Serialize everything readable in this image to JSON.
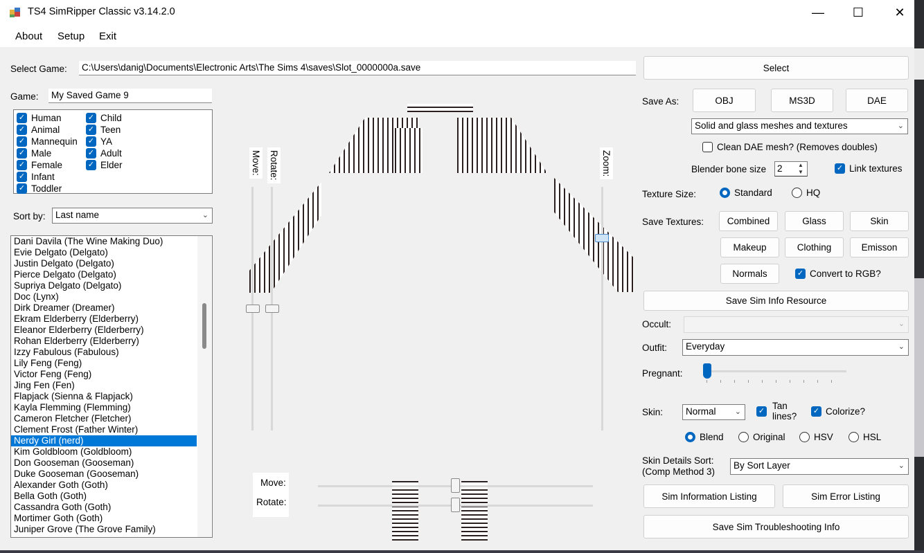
{
  "window": {
    "title": "TS4 SimRipper Classic v3.14.2.0",
    "min_icon": "—",
    "max_icon": "☐",
    "close_icon": "✕"
  },
  "menu": {
    "about": "About",
    "setup": "Setup",
    "exit": "Exit"
  },
  "select_game": {
    "label": "Select Game:",
    "path": "C:\\Users\\danig\\Documents\\Electronic Arts\\The Sims 4\\saves\\Slot_0000000a.save",
    "button": "Select"
  },
  "game": {
    "label": "Game:",
    "value": "My Saved Game 9"
  },
  "filters": {
    "col1": [
      "Human",
      "Animal",
      "Mannequin",
      "Male",
      "Female",
      "Infant",
      "Toddler"
    ],
    "col2": [
      "Child",
      "Teen",
      "YA",
      "Adult",
      "Elder"
    ]
  },
  "sort": {
    "label": "Sort by:",
    "value": "Last name"
  },
  "sim_list": [
    "Dani Davila (The Wine Making Duo)",
    "Evie Delgato (Delgato)",
    "Justin Delgato (Delgato)",
    "Pierce Delgato (Delgato)",
    "Supriya Delgato (Delgato)",
    "Doc  (Lynx)",
    "Dirk Dreamer (Dreamer)",
    "Ekram Elderberry (Elderberry)",
    "Eleanor Elderberry (Elderberry)",
    "Rohan Elderberry (Elderberry)",
    "Izzy Fabulous (Fabulous)",
    "Lily Feng (Feng)",
    "Victor Feng (Feng)",
    "Jing Fen (Fen)",
    "Flapjack  (Sienna & Flapjack)",
    "Kayla Flemming (Flemming)",
    "Cameron Fletcher (Fletcher)",
    "Clement Frost (Father Winter)",
    "Nerdy Girl (nerd)",
    "Kim Goldbloom (Goldbloom)",
    "Don Gooseman (Gooseman)",
    "Duke Gooseman (Gooseman)",
    "Alexander Goth (Goth)",
    "Bella Goth (Goth)",
    "Cassandra Goth (Goth)",
    "Mortimer Goth (Goth)",
    "Juniper Grove (The Grove Family)"
  ],
  "selected_index": 18,
  "viewport": {
    "move_label": "Move:",
    "rotate_label": "Rotate:",
    "zoom_label": "Zoom:",
    "bottom_move": "Move:",
    "bottom_rotate": "Rotate:"
  },
  "save_as": {
    "label": "Save As:",
    "obj": "OBJ",
    "ms3d": "MS3D",
    "dae": "DAE",
    "mesh_option": "Solid and glass meshes and textures"
  },
  "clean_dae": "Clean DAE mesh? (Removes doubles)",
  "blender_bone": {
    "label": "Blender bone size",
    "value": "2"
  },
  "link_textures": "Link textures",
  "texture_size": {
    "label": "Texture Size:",
    "standard": "Standard",
    "hq": "HQ"
  },
  "save_textures": {
    "label": "Save Textures:",
    "combined": "Combined",
    "glass": "Glass",
    "skin": "Skin",
    "makeup": "Makeup",
    "clothing": "Clothing",
    "emisson": "Emisson",
    "normals": "Normals",
    "convert_rgb": "Convert to RGB?"
  },
  "save_sim_info": "Save Sim Info Resource",
  "occult": {
    "label": "Occult:",
    "value": ""
  },
  "outfit": {
    "label": "Outfit:",
    "value": "Everyday"
  },
  "pregnant": {
    "label": "Pregnant:",
    "level": 0
  },
  "skin": {
    "label": "Skin:",
    "value": "Normal",
    "tan_lines": "Tan\nlines?",
    "colorize": "Colorize?",
    "blend": "Blend",
    "original": "Original",
    "hsv": "HSV",
    "hsl": "HSL"
  },
  "skin_details": {
    "label1": "Skin Details Sort:",
    "label2": "(Comp Method 3)",
    "value": "By Sort Layer"
  },
  "sim_info_listing": "Sim Information Listing",
  "sim_error_listing": "Sim Error Listing",
  "save_troubleshooting": "Save Sim Troubleshooting Info",
  "icons": {
    "app": "app-icon",
    "check": "✓",
    "chevron": "⌄"
  }
}
